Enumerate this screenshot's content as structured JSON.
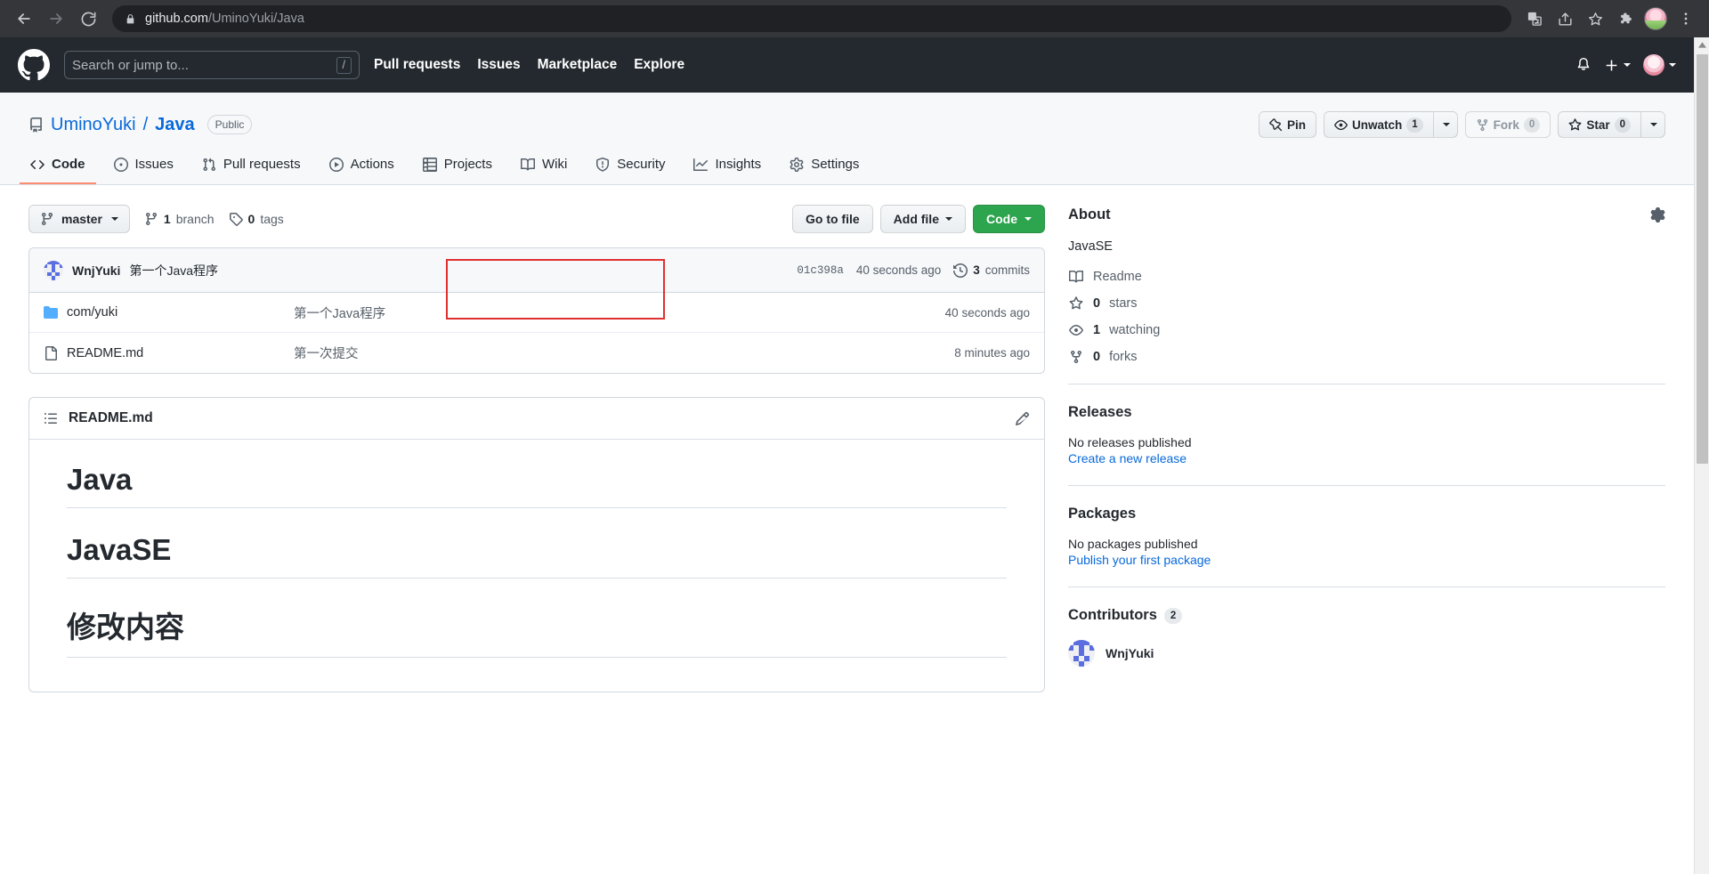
{
  "browser": {
    "back_icon": "back-arrow-icon",
    "forward_icon": "forward-arrow-icon",
    "reload_icon": "reload-icon",
    "lock_icon": "lock-icon",
    "url_domain": "github.com",
    "url_path": "/UminoYuki/Java",
    "icons": [
      "translate-icon",
      "share-icon",
      "bookmark-star-icon",
      "extensions-puzzle-icon",
      "profile-avatar",
      "more-menu-icon"
    ]
  },
  "gh_header": {
    "logo": "github-mark-icon",
    "search_placeholder": "Search or jump to...",
    "search_key": "/",
    "nav": [
      {
        "label": "Pull requests"
      },
      {
        "label": "Issues"
      },
      {
        "label": "Marketplace"
      },
      {
        "label": "Explore"
      }
    ],
    "notifications_icon": "bell-icon",
    "create_new_icon": "plus-icon",
    "account_icon": "user-avatar"
  },
  "repo": {
    "owner": "UminoYuki",
    "separator": "/",
    "name": "Java",
    "visibility": "Public",
    "actions": {
      "pin": "Pin",
      "unwatch": "Unwatch",
      "unwatch_count": "1",
      "fork": "Fork",
      "fork_count": "0",
      "star": "Star",
      "star_count": "0"
    },
    "tabs": [
      {
        "label": "Code",
        "icon": "code-icon",
        "active": true
      },
      {
        "label": "Issues",
        "icon": "issue-opened-icon",
        "active": false
      },
      {
        "label": "Pull requests",
        "icon": "git-pull-request-icon",
        "active": false
      },
      {
        "label": "Actions",
        "icon": "play-icon",
        "active": false
      },
      {
        "label": "Projects",
        "icon": "table-icon",
        "active": false
      },
      {
        "label": "Wiki",
        "icon": "book-icon",
        "active": false
      },
      {
        "label": "Security",
        "icon": "shield-icon",
        "active": false
      },
      {
        "label": "Insights",
        "icon": "graph-icon",
        "active": false
      },
      {
        "label": "Settings",
        "icon": "gear-icon",
        "active": false
      }
    ]
  },
  "file_toolbar": {
    "branch": "master",
    "branch_count": "1",
    "branch_label": "branch",
    "tag_count": "0",
    "tag_label": "tags",
    "go_to_file": "Go to file",
    "add_file": "Add file",
    "code": "Code"
  },
  "latest_commit": {
    "author": "WnjYuki",
    "message": "第一个Java程序",
    "sha": "01c398a",
    "time": "40 seconds ago",
    "commits_count": "3",
    "commits_label": "commits"
  },
  "files": [
    {
      "name": "com/yuki",
      "type": "folder",
      "message": "第一个Java程序",
      "time": "40 seconds ago"
    },
    {
      "name": "README.md",
      "type": "file",
      "message": "第一次提交",
      "time": "8 minutes ago"
    }
  ],
  "readme": {
    "title": "README.md",
    "list_icon": "list-unordered-icon",
    "edit_icon": "pencil-icon",
    "headings": [
      "Java",
      "JavaSE",
      "修改内容"
    ]
  },
  "sidebar": {
    "about": {
      "title": "About",
      "gear_icon": "gear-icon",
      "description": "JavaSE",
      "items": [
        {
          "icon": "book-icon",
          "label": "Readme",
          "value": ""
        },
        {
          "icon": "star-icon",
          "label": "stars",
          "value": "0"
        },
        {
          "icon": "eye-icon",
          "label": "watching",
          "value": "1"
        },
        {
          "icon": "fork-icon",
          "label": "forks",
          "value": "0"
        }
      ]
    },
    "releases": {
      "title": "Releases",
      "empty": "No releases published",
      "link": "Create a new release"
    },
    "packages": {
      "title": "Packages",
      "empty": "No packages published",
      "link": "Publish your first package"
    },
    "contributors": {
      "title": "Contributors",
      "count": "2",
      "people": [
        {
          "name": "WnjYuki"
        }
      ]
    }
  },
  "colors": {
    "accent": "#0969da",
    "green": "#2da44e",
    "tab_underline": "#fd8c73",
    "annotation": "#e03030",
    "header_bg": "#24292f"
  }
}
